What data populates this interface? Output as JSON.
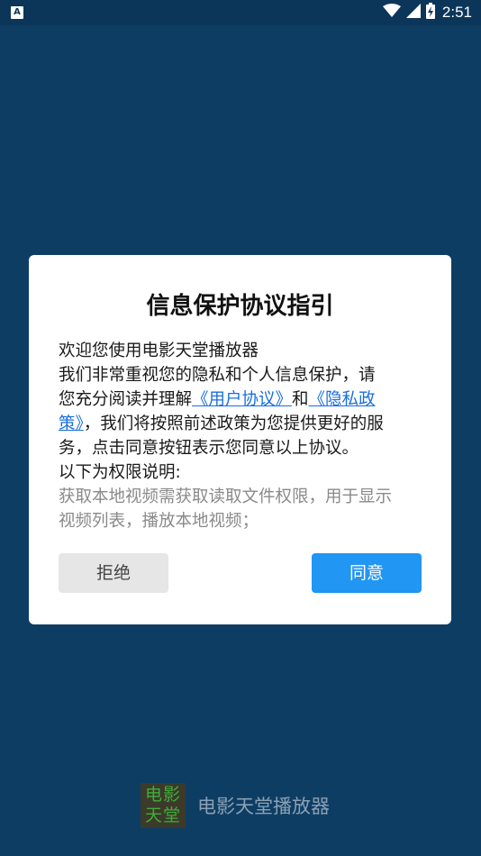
{
  "status_bar": {
    "notification_icon": "A",
    "time": "2:51",
    "icons": [
      "wifi-icon",
      "signal-icon",
      "battery-icon"
    ]
  },
  "dialog": {
    "title": "信息保护协议指引",
    "welcome": "欢迎您使用电影天堂播放器",
    "para_a": "我们非常重视您的隐私和个人信息保护，请",
    "para_b": "您充分阅读并理解",
    "link_user": "《用户协议》",
    "and_word": "和",
    "link_privacy_a": "《隐私政",
    "link_privacy_b": "策》",
    "para_c": "，我们将按照前述政策为您提供更好的服",
    "para_d": "务，点击同意按钮表示您同意以上协议。",
    "perm_heading": "以下为权限说明:",
    "perm_line_a": "获取本地视频需获取读取文件权限，用于显示",
    "perm_line_b": "视频列表，播放本地视频；",
    "reject_label": "拒绝",
    "agree_label": "同意"
  },
  "footer": {
    "logo_top": "电影",
    "logo_bottom": "天堂",
    "app_name": "电影天堂播放器"
  },
  "colors": {
    "background": "#0e3d63",
    "link": "#1a6fe0",
    "agree_button": "#2196f3",
    "reject_button": "#e6e6e6"
  }
}
